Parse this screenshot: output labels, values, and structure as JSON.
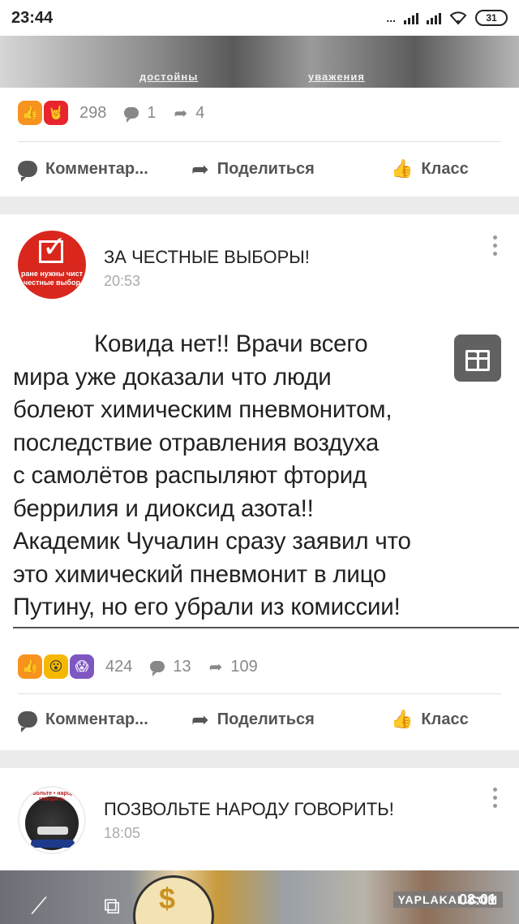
{
  "status_bar": {
    "time": "23:44",
    "network": "...",
    "battery": "31"
  },
  "prev_post": {
    "image_caption_left": "достойны",
    "image_caption_right": "уважения",
    "reaction_count": "298",
    "comment_count": "1",
    "share_count": "4"
  },
  "actions": {
    "comment_label": "Комментар...",
    "share_label": "Поделиться",
    "class_label": "Класс"
  },
  "post1": {
    "group_name": "ЗА ЧЕСТНЫЕ ВЫБОРЫ!",
    "time": "20:53",
    "avatar_text_line1": "ране нужны чист",
    "avatar_text_line2": "честные выбор",
    "text_lines": [
      "Ковида нет!! Врачи всего",
      "мира уже доказали что люди",
      "болеют химическим пневмонитом,",
      "последствие отравления воздуха",
      "с самолётов распыляют фторид",
      "беррилия и диоксид азота!!",
      "Академик Чучалин сразу заявил что",
      "это химический пневмонит в лицо",
      "Путину, но его убрали из комиссии!"
    ],
    "reaction_count": "424",
    "comment_count": "13",
    "share_count": "109"
  },
  "post2": {
    "group_name": "ПОЗВОЛЬТЕ НАРОДУ ГОВОРИТЬ!",
    "time": "18:05",
    "avatar_ring_text": "позвольте • народу • говорить"
  },
  "video": {
    "watermark": "YAPLAKAL.COM",
    "time": "08:01"
  },
  "colors": {
    "like_orange": "#f7931e",
    "rock_red": "#e8242c",
    "avatar_red": "#d9271e",
    "gift_gray": "#616161"
  }
}
